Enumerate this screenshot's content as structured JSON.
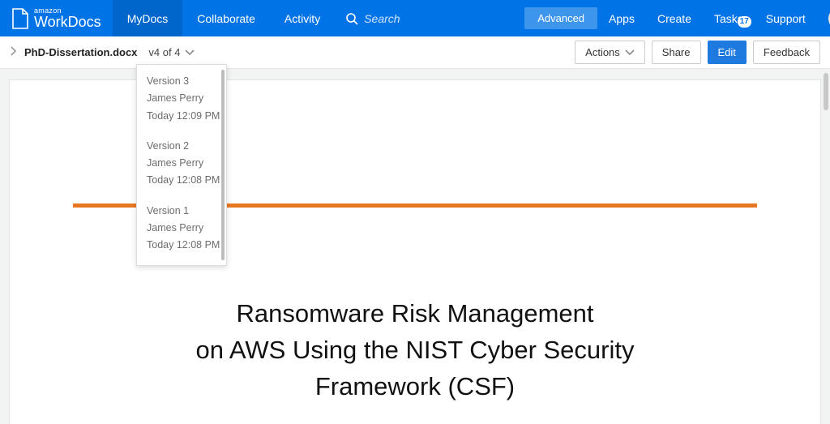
{
  "brand": {
    "small": "amazon",
    "big": "WorkDocs"
  },
  "nav": {
    "mydocs": "MyDocs",
    "collaborate": "Collaborate",
    "activity": "Activity"
  },
  "search": {
    "placeholder": "Search",
    "advanced": "Advanced"
  },
  "rightnav": {
    "apps": "Apps",
    "create": "Create",
    "tasks": "Tasks",
    "tasks_badge": "17",
    "support": "Support"
  },
  "breadcrumb": {
    "filename": "PhD-Dissertation.docx"
  },
  "version_toggle": "v4 of 4",
  "actions": {
    "actions": "Actions",
    "share": "Share",
    "edit": "Edit",
    "feedback": "Feedback"
  },
  "versions": [
    {
      "name": "Version 3",
      "author": "James Perry",
      "time": "Today 12:09 PM"
    },
    {
      "name": "Version 2",
      "author": "James Perry",
      "time": "Today 12:08 PM"
    },
    {
      "name": "Version 1",
      "author": "James Perry",
      "time": "Today 12:08 PM"
    }
  ],
  "document": {
    "title_line1": "Ransomware Risk Management",
    "title_line2": "on AWS Using the NIST Cyber Security",
    "title_line3": "Framework (CSF)"
  }
}
